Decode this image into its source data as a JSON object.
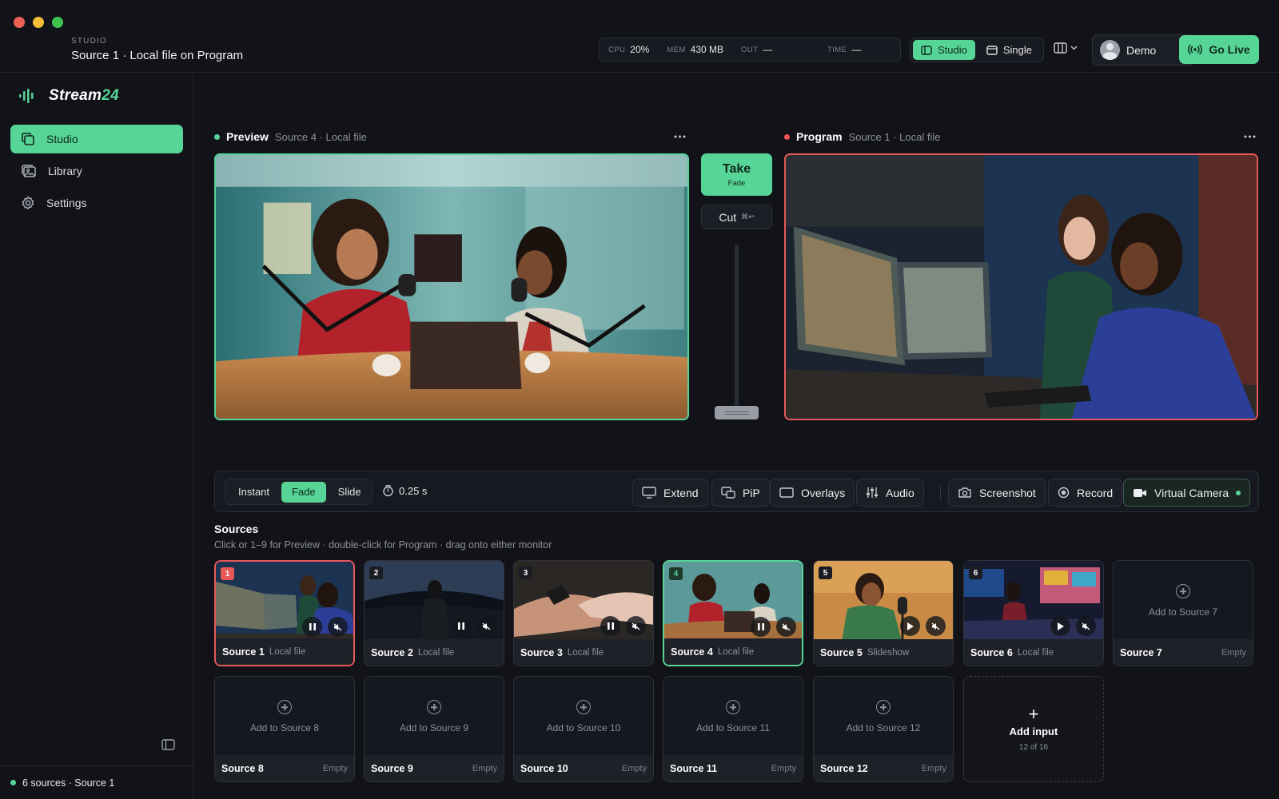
{
  "header": {
    "kicker": "STUDIO",
    "title": "Source 1 · Local file on Program",
    "stats": [
      {
        "key": "CPU",
        "value": "20%"
      },
      {
        "key": "MEM",
        "value": "430 MB"
      },
      {
        "key": "OUT",
        "value": "—"
      },
      {
        "key": "TIME",
        "value": "—"
      }
    ],
    "mode_studio": "Studio",
    "mode_single": "Single",
    "user": "Demo",
    "go_live": "Go Live"
  },
  "sidebar": {
    "brand_a": "Stream",
    "brand_b": "24",
    "items": [
      {
        "label": "Studio",
        "icon": "copy-icon"
      },
      {
        "label": "Library",
        "icon": "images-icon"
      },
      {
        "label": "Settings",
        "icon": "gear-icon"
      }
    ],
    "footer": "6 sources · Source 1"
  },
  "preview": {
    "name": "Preview",
    "sub": "Source 4 · Local file"
  },
  "program": {
    "name": "Program",
    "sub": "Source 1 · Local file"
  },
  "transition": {
    "take": "Take",
    "take_sub": "Fade",
    "cut": "Cut",
    "cut_shortcut": "⌘↩"
  },
  "toolbar": {
    "modes": [
      "Instant",
      "Fade",
      "Slide"
    ],
    "duration": "0.25 s",
    "extend": "Extend",
    "pip": "PiP",
    "overlays": "Overlays",
    "audio": "Audio",
    "screenshot": "Screenshot",
    "record": "Record",
    "virtual_camera": "Virtual Camera"
  },
  "sources": {
    "title": "Sources",
    "hint": "Click or 1–9 for Preview · double-click for Program · drag onto either monitor",
    "cards": [
      {
        "num": "1",
        "name": "Source 1",
        "type": "Local file"
      },
      {
        "num": "2",
        "name": "Source 2",
        "type": "Local file"
      },
      {
        "num": "3",
        "name": "Source 3",
        "type": "Local file"
      },
      {
        "num": "4",
        "name": "Source 4",
        "type": "Local file"
      },
      {
        "num": "5",
        "name": "Source 5",
        "type": "Slideshow"
      },
      {
        "num": "6",
        "name": "Source 6",
        "type": "Local file"
      }
    ],
    "empty": [
      {
        "add": "Add to Source 7",
        "name": "Source 7",
        "state": "Empty"
      },
      {
        "add": "Add to Source 8",
        "name": "Source 8",
        "state": "Empty"
      },
      {
        "add": "Add to Source 9",
        "name": "Source 9",
        "state": "Empty"
      },
      {
        "add": "Add to Source 10",
        "name": "Source 10",
        "state": "Empty"
      },
      {
        "add": "Add to Source 11",
        "name": "Source 11",
        "state": "Empty"
      },
      {
        "add": "Add to Source 12",
        "name": "Source 12",
        "state": "Empty"
      }
    ],
    "add_input": "Add input",
    "add_input_count": "12 of 16"
  }
}
